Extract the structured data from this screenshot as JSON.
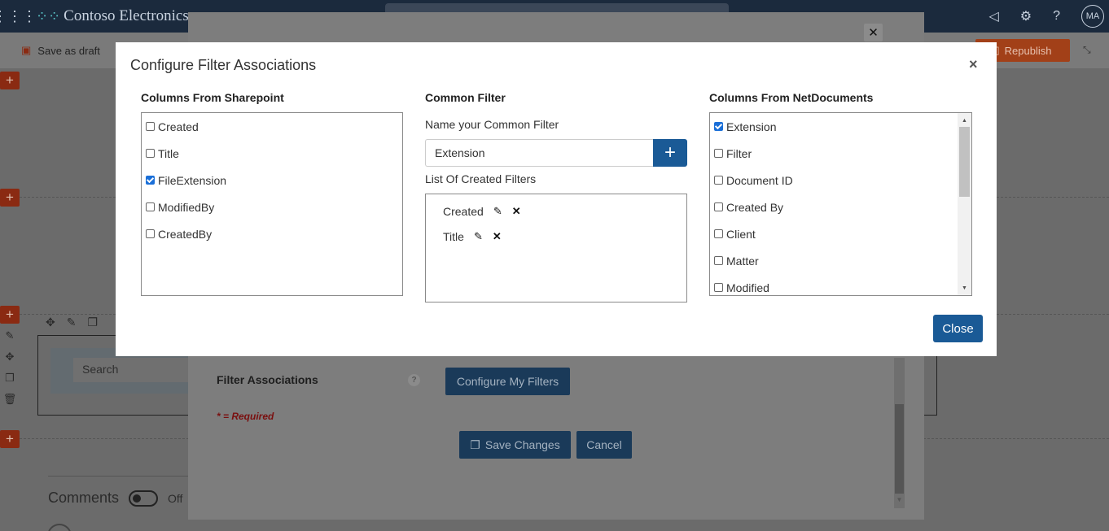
{
  "app": {
    "brand": "Contoso Electronics",
    "avatar": "MA",
    "save_as_draft": "Save as draft",
    "republish": "Republish"
  },
  "background": {
    "search_placeholder": "Search",
    "comments_label": "Comments",
    "comments_toggle": "Off"
  },
  "settings_panel": {
    "filter_associations_label": "Filter Associations",
    "help": "?",
    "configure_button": "Configure My Filters",
    "required_note": "* = Required",
    "save_button": "Save Changes",
    "cancel_button": "Cancel"
  },
  "modal": {
    "title": "Configure Filter Associations",
    "close_x": "×",
    "sharepoint": {
      "heading": "Columns From Sharepoint",
      "items": [
        {
          "label": "Created",
          "checked": false
        },
        {
          "label": "Title",
          "checked": false
        },
        {
          "label": "FileExtension",
          "checked": true
        },
        {
          "label": "ModifiedBy",
          "checked": false
        },
        {
          "label": "CreatedBy",
          "checked": false
        }
      ]
    },
    "common": {
      "heading": "Common Filter",
      "name_label": "Name your Common Filter",
      "name_value": "Extension",
      "add_icon": "+",
      "list_label": "List Of Created Filters",
      "filters": [
        "Created",
        "Title"
      ]
    },
    "netdocs": {
      "heading": "Columns From NetDocuments",
      "items": [
        {
          "label": "Extension",
          "checked": true
        },
        {
          "label": "Filter",
          "checked": false
        },
        {
          "label": "Document ID",
          "checked": false
        },
        {
          "label": "Created By",
          "checked": false
        },
        {
          "label": "Client",
          "checked": false
        },
        {
          "label": "Matter",
          "checked": false
        },
        {
          "label": "Modified",
          "checked": false
        }
      ]
    },
    "close_button": "Close"
  }
}
